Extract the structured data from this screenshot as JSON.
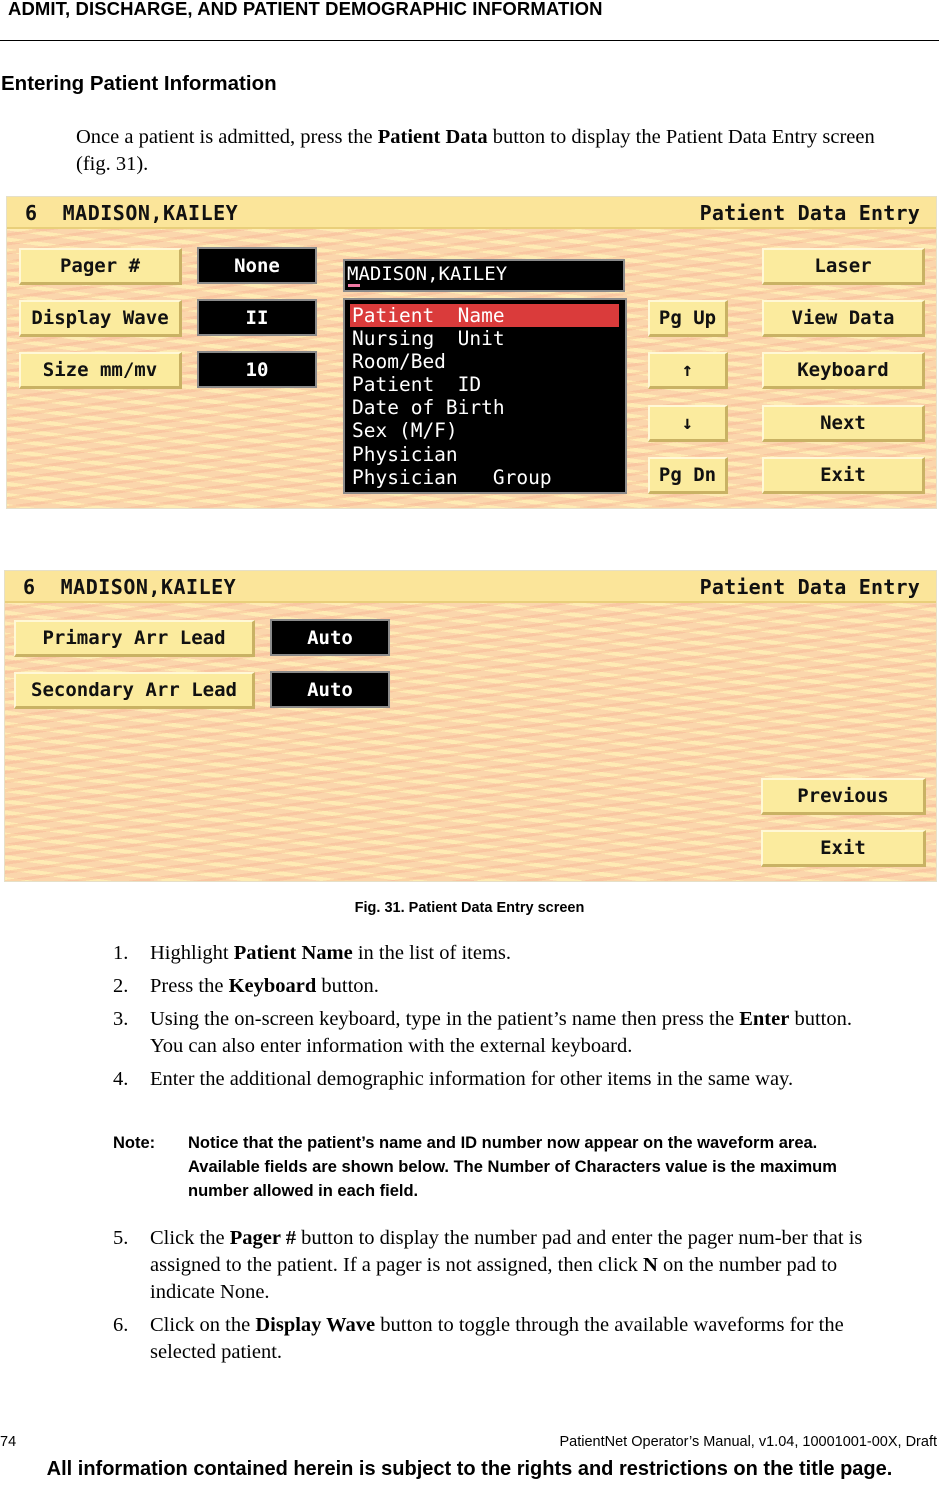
{
  "header": {
    "running_head": "ADMIT, DISCHARGE, AND PATIENT DEMOGRAPHIC INFORMATION"
  },
  "section": {
    "title": "Entering Patient Information",
    "intro": {
      "before": "Once a patient is admitted, press the ",
      "bold": "Patient Data",
      "after": " button to display the Patient Data Entry screen (fig. 31)."
    }
  },
  "screen1": {
    "bed": "6",
    "patient": "MADISON,KAILEY",
    "title": "Patient Data Entry",
    "left_buttons": [
      {
        "label": "Pager #",
        "value": "None"
      },
      {
        "label": "Display Wave",
        "value": "II"
      },
      {
        "label": "Size mm/mv",
        "value": "10"
      }
    ],
    "name_field_value": "MADISON,KAILEY",
    "list_items": [
      "Patient  Name",
      "Nursing  Unit",
      "Room/Bed",
      "Patient  ID",
      "Date of Birth",
      "Sex (M/F)",
      "Physician",
      "Physician   Group"
    ],
    "selected_index": 0,
    "nav_buttons": {
      "pg_up": "Pg Up",
      "up": "↑",
      "down": "↓",
      "pg_dn": "Pg Dn"
    },
    "right_buttons": [
      "Laser",
      "View Data",
      "Keyboard",
      "Next",
      "Exit"
    ]
  },
  "screen2": {
    "bed": "6",
    "patient": "MADISON,KAILEY",
    "title": "Patient Data Entry",
    "left_buttons": [
      {
        "label": "Primary Arr Lead",
        "value": "Auto"
      },
      {
        "label": "Secondary Arr Lead",
        "value": "Auto"
      }
    ],
    "right_buttons": [
      "Previous",
      "Exit"
    ]
  },
  "colors": {
    "selected_row": "#da3b3b",
    "button_face": "#fbeb9e",
    "titlebar": "#fbe59a",
    "cursor": "#f07aa4"
  },
  "caption": "Fig. 31. Patient Data Entry screen",
  "steps_a": [
    {
      "num": "1.",
      "before": "Highlight ",
      "bold": "Patient Name",
      "after": " in the list of items."
    },
    {
      "num": "2.",
      "before": "Press the ",
      "bold": "Keyboard",
      "after": " button."
    },
    {
      "num": "3.",
      "before": "Using the on-screen keyboard, type in the patient’s name then press the ",
      "bold": "Enter",
      "after": " button. You can also enter information with the external keyboard."
    },
    {
      "num": "4.",
      "before": "Enter the additional demographic information for other items in the same way.",
      "bold": "",
      "after": ""
    }
  ],
  "note": {
    "label": "Note:",
    "text": "Notice that the patient’s name and ID number now appear on the waveform area. Available fields are shown below. The Number of Characters value is the maximum number allowed in each field."
  },
  "steps_b": [
    {
      "num": "5.",
      "before": "Click the ",
      "bold": "Pager #",
      "after": " button to display the number pad and enter the pager num-ber that is assigned to the patient. If a pager is not assigned, then click ",
      "bold2": "N",
      "after2": " on the number pad to indicate None."
    },
    {
      "num": "6.",
      "before": "Click on the ",
      "bold": "Display Wave",
      "after": " button to toggle through the available waveforms for the selected patient.",
      "bold2": "",
      "after2": ""
    }
  ],
  "footer": {
    "page_number": "74",
    "manual": "PatientNet Operator’s Manual, v1.04, 10001001-00X, Draft",
    "legal": "All information contained herein is subject to the rights and restrictions on the title page."
  }
}
